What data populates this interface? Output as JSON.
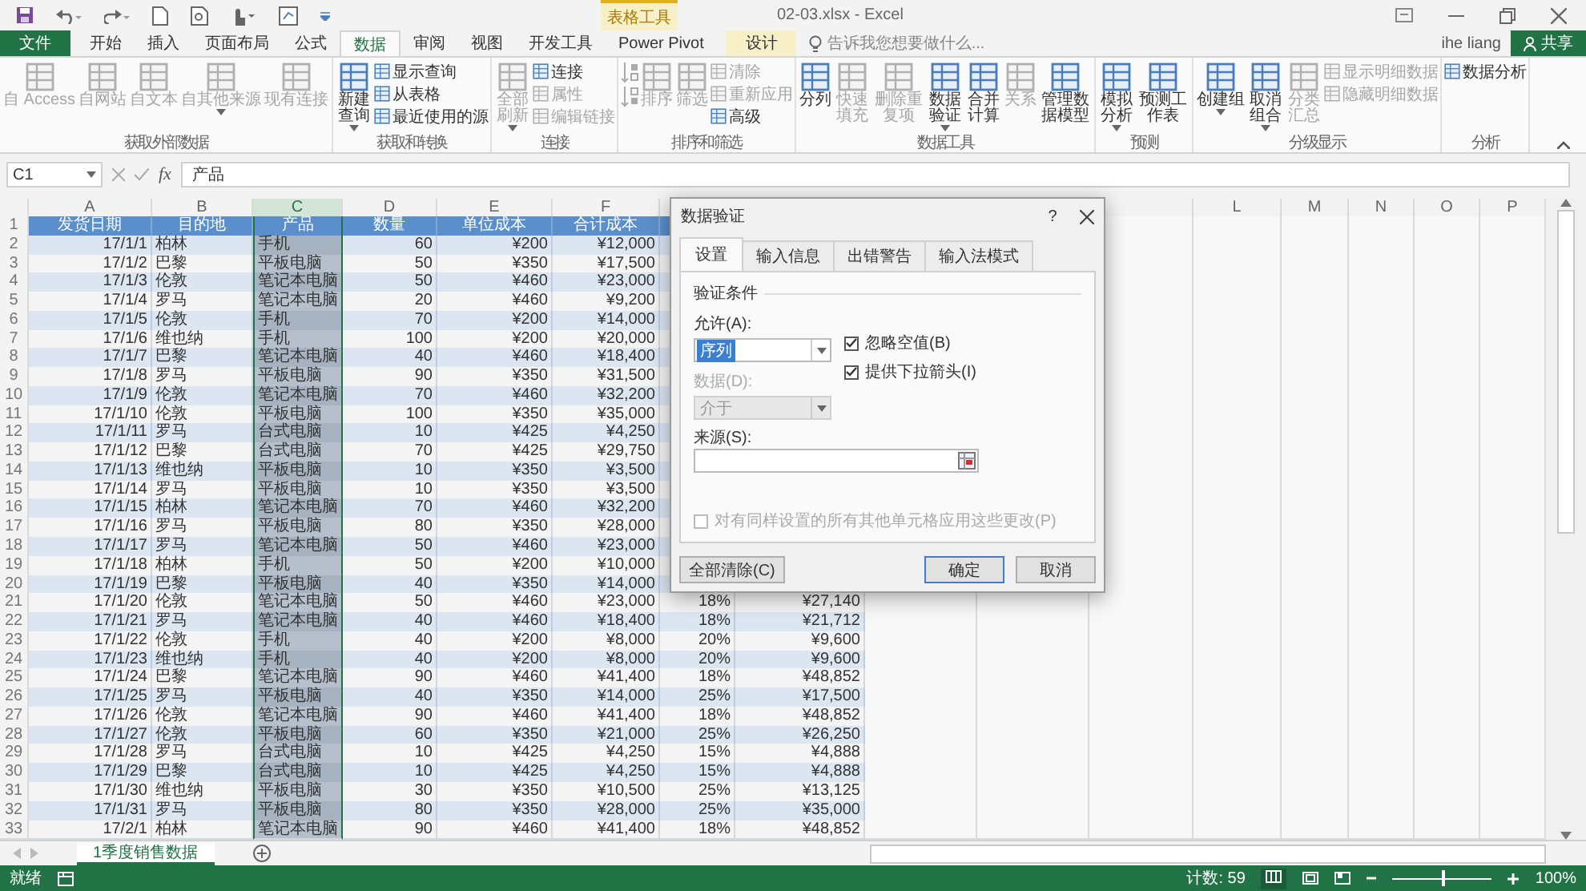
{
  "title_bar": {
    "context_label": "表格工具",
    "title": "02-03.xlsx - Excel"
  },
  "tabs": [
    {
      "label": "文件",
      "kind": "file",
      "selected": false
    },
    {
      "label": "开始",
      "kind": "tab",
      "selected": false
    },
    {
      "label": "插入",
      "kind": "tab",
      "selected": false
    },
    {
      "label": "页面布局",
      "kind": "tab",
      "selected": false
    },
    {
      "label": "公式",
      "kind": "tab",
      "selected": false
    },
    {
      "label": "数据",
      "kind": "tab",
      "selected": true
    },
    {
      "label": "审阅",
      "kind": "tab",
      "selected": false
    },
    {
      "label": "视图",
      "kind": "tab",
      "selected": false
    },
    {
      "label": "开发工具",
      "kind": "tab",
      "selected": false
    },
    {
      "label": "Power Pivot",
      "kind": "tab",
      "selected": false
    },
    {
      "label": "设计",
      "kind": "context",
      "selected": false
    }
  ],
  "search": {
    "placeholder": "告诉我您想要做什么..."
  },
  "user": {
    "name": "ihe liang",
    "share": "共享"
  },
  "ribbon": [
    {
      "label": "获取外部数据",
      "items": [
        {
          "kind": "large",
          "label": "自 Access",
          "disabled": true
        },
        {
          "kind": "large",
          "label": "自网站",
          "disabled": true
        },
        {
          "kind": "large",
          "label": "自文本",
          "disabled": true
        },
        {
          "kind": "large",
          "label": "自其他来源",
          "disabled": true,
          "dropdown": true
        },
        {
          "kind": "large",
          "label": "现有连接",
          "disabled": true
        }
      ]
    },
    {
      "label": "获取和转换",
      "items": [
        {
          "kind": "large",
          "label": "新建查询",
          "wrap": true,
          "disabled": false,
          "dropdown": true
        },
        {
          "kind": "stack",
          "items": [
            {
              "label": "显示查询",
              "disabled": false
            },
            {
              "label": "从表格",
              "disabled": false
            },
            {
              "label": "最近使用的源",
              "disabled": false
            }
          ]
        }
      ]
    },
    {
      "label": "连接",
      "items": [
        {
          "kind": "large",
          "label": "全部刷新",
          "disabled": true,
          "dropdown": true,
          "wrap": true
        },
        {
          "kind": "stack",
          "items": [
            {
              "label": "连接",
              "disabled": false
            },
            {
              "label": "属性",
              "disabled": true
            },
            {
              "label": "编辑链接",
              "disabled": true
            }
          ]
        }
      ]
    },
    {
      "label": "排序和筛选",
      "items": [
        {
          "kind": "sort_icons",
          "disabled": true
        },
        {
          "kind": "large",
          "label": "排序",
          "disabled": true
        },
        {
          "kind": "large",
          "label": "筛选",
          "disabled": true
        },
        {
          "kind": "stack",
          "items": [
            {
              "label": "清除",
              "disabled": true
            },
            {
              "label": "重新应用",
              "disabled": true
            },
            {
              "label": "高级",
              "disabled": false
            }
          ]
        }
      ]
    },
    {
      "label": "数据工具",
      "items": [
        {
          "kind": "large",
          "label": "分列",
          "disabled": false
        },
        {
          "kind": "large",
          "label": "快速填充",
          "disabled": true,
          "wrap": true
        },
        {
          "kind": "large",
          "label": "删除重复项",
          "wrap": true,
          "disabled": true
        },
        {
          "kind": "large",
          "label": "数据验证",
          "wrap": true,
          "disabled": false,
          "dropdown": true
        },
        {
          "kind": "large",
          "label": "合并计算",
          "disabled": false,
          "wrap": true
        },
        {
          "kind": "large",
          "label": "关系",
          "disabled": true
        },
        {
          "kind": "large",
          "label": "管理数据模型",
          "wrap": true,
          "disabled": false
        }
      ]
    },
    {
      "label": "预测",
      "items": [
        {
          "kind": "large",
          "label": "模拟分析",
          "disabled": false,
          "dropdown": true,
          "wrap": true
        },
        {
          "kind": "large",
          "label": "预测工作表",
          "wrap": true,
          "disabled": false
        }
      ]
    },
    {
      "label": "分级显示",
      "items": [
        {
          "kind": "large",
          "label": "创建组",
          "disabled": false,
          "dropdown": true
        },
        {
          "kind": "large",
          "label": "取消组合",
          "disabled": false,
          "dropdown": true,
          "wrap": true
        },
        {
          "kind": "large",
          "label": "分类汇总",
          "disabled": true,
          "wrap": true
        },
        {
          "kind": "stack",
          "items": [
            {
              "label": "显示明细数据",
              "disabled": true
            },
            {
              "label": "隐藏明细数据",
              "disabled": true
            }
          ]
        }
      ]
    },
    {
      "label": "分析",
      "items": [
        {
          "kind": "stack",
          "items": [
            {
              "label": "数据分析",
              "disabled": false
            }
          ]
        }
      ]
    }
  ],
  "formula_bar": {
    "name_box": "C1",
    "function_label": "fx",
    "value": "产品"
  },
  "sheet": {
    "column_headers_left": [
      {
        "letter": "A",
        "selected": false
      },
      {
        "letter": "B",
        "selected": false
      },
      {
        "letter": "C",
        "selected": true
      },
      {
        "letter": "D",
        "selected": false
      },
      {
        "letter": "E",
        "selected": false
      },
      {
        "letter": "F",
        "selected": false
      }
    ],
    "column_headers_right": [
      {
        "letter": "L",
        "selected": false
      },
      {
        "letter": "M",
        "selected": false
      },
      {
        "letter": "N",
        "selected": false
      },
      {
        "letter": "O",
        "selected": false
      },
      {
        "letter": "P",
        "selected": false
      }
    ],
    "rows": [
      {
        "number": "1",
        "kind": "header",
        "cells": [
          "发货日期",
          "目的地",
          "产品",
          "数量",
          "单位成本",
          "合计成本"
        ]
      },
      {
        "number": "2",
        "kind": "data",
        "cells": [
          "17/1/1",
          "柏林",
          "手机",
          "60",
          "¥200",
          "¥12,000"
        ]
      },
      {
        "number": "3",
        "kind": "data",
        "cells": [
          "17/1/2",
          "巴黎",
          "平板电脑",
          "50",
          "¥350",
          "¥17,500"
        ]
      },
      {
        "number": "4",
        "kind": "data",
        "cells": [
          "17/1/3",
          "伦敦",
          "笔记本电脑",
          "50",
          "¥460",
          "¥23,000"
        ]
      },
      {
        "number": "5",
        "kind": "data",
        "cells": [
          "17/1/4",
          "罗马",
          "笔记本电脑",
          "20",
          "¥460",
          "¥9,200"
        ]
      },
      {
        "number": "6",
        "kind": "data",
        "cells": [
          "17/1/5",
          "伦敦",
          "手机",
          "70",
          "¥200",
          "¥14,000"
        ]
      },
      {
        "number": "7",
        "kind": "data",
        "cells": [
          "17/1/6",
          "维也纳",
          "手机",
          "100",
          "¥200",
          "¥20,000"
        ]
      },
      {
        "number": "8",
        "kind": "data",
        "cells": [
          "17/1/7",
          "巴黎",
          "笔记本电脑",
          "40",
          "¥460",
          "¥18,400"
        ]
      },
      {
        "number": "9",
        "kind": "data",
        "cells": [
          "17/1/8",
          "罗马",
          "平板电脑",
          "90",
          "¥350",
          "¥31,500"
        ]
      },
      {
        "number": "10",
        "kind": "data",
        "cells": [
          "17/1/9",
          "伦敦",
          "笔记本电脑",
          "70",
          "¥460",
          "¥32,200"
        ]
      },
      {
        "number": "11",
        "kind": "data",
        "cells": [
          "17/1/10",
          "伦敦",
          "平板电脑",
          "100",
          "¥350",
          "¥35,000"
        ]
      },
      {
        "number": "12",
        "kind": "data",
        "cells": [
          "17/1/11",
          "罗马",
          "台式电脑",
          "10",
          "¥425",
          "¥4,250"
        ]
      },
      {
        "number": "13",
        "kind": "data",
        "cells": [
          "17/1/12",
          "巴黎",
          "台式电脑",
          "70",
          "¥425",
          "¥29,750"
        ]
      },
      {
        "number": "14",
        "kind": "data",
        "cells": [
          "17/1/13",
          "维也纳",
          "平板电脑",
          "10",
          "¥350",
          "¥3,500"
        ]
      },
      {
        "number": "15",
        "kind": "data",
        "cells": [
          "17/1/14",
          "罗马",
          "平板电脑",
          "10",
          "¥350",
          "¥3,500"
        ]
      },
      {
        "number": "16",
        "kind": "data",
        "cells": [
          "17/1/15",
          "柏林",
          "笔记本电脑",
          "70",
          "¥460",
          "¥32,200"
        ]
      },
      {
        "number": "17",
        "kind": "data",
        "cells": [
          "17/1/16",
          "罗马",
          "平板电脑",
          "80",
          "¥350",
          "¥28,000"
        ]
      },
      {
        "number": "18",
        "kind": "data",
        "cells": [
          "17/1/17",
          "罗马",
          "笔记本电脑",
          "50",
          "¥460",
          "¥23,000"
        ]
      },
      {
        "number": "19",
        "kind": "data",
        "cells": [
          "17/1/18",
          "柏林",
          "手机",
          "50",
          "¥200",
          "¥10,000"
        ]
      },
      {
        "number": "20",
        "kind": "data",
        "cells": [
          "17/1/19",
          "巴黎",
          "平板电脑",
          "40",
          "¥350",
          "¥14,000"
        ]
      },
      {
        "number": "21",
        "kind": "data",
        "cells": [
          "17/1/20",
          "伦敦",
          "笔记本电脑",
          "50",
          "¥460",
          "¥23,000",
          "18%",
          "¥27,140"
        ]
      },
      {
        "number": "22",
        "kind": "data",
        "cells": [
          "17/1/21",
          "罗马",
          "笔记本电脑",
          "40",
          "¥460",
          "¥18,400",
          "18%",
          "¥21,712"
        ]
      },
      {
        "number": "23",
        "kind": "data",
        "cells": [
          "17/1/22",
          "伦敦",
          "手机",
          "40",
          "¥200",
          "¥8,000",
          "20%",
          "¥9,600"
        ]
      },
      {
        "number": "24",
        "kind": "data",
        "cells": [
          "17/1/23",
          "维也纳",
          "手机",
          "40",
          "¥200",
          "¥8,000",
          "20%",
          "¥9,600"
        ]
      },
      {
        "number": "25",
        "kind": "data",
        "cells": [
          "17/1/24",
          "巴黎",
          "笔记本电脑",
          "90",
          "¥460",
          "¥41,400",
          "18%",
          "¥48,852"
        ]
      },
      {
        "number": "26",
        "kind": "data",
        "cells": [
          "17/1/25",
          "罗马",
          "平板电脑",
          "40",
          "¥350",
          "¥14,000",
          "25%",
          "¥17,500"
        ]
      },
      {
        "number": "27",
        "kind": "data",
        "cells": [
          "17/1/26",
          "伦敦",
          "笔记本电脑",
          "90",
          "¥460",
          "¥41,400",
          "18%",
          "¥48,852"
        ]
      },
      {
        "number": "28",
        "kind": "data",
        "cells": [
          "17/1/27",
          "伦敦",
          "平板电脑",
          "60",
          "¥350",
          "¥21,000",
          "25%",
          "¥26,250"
        ]
      },
      {
        "number": "29",
        "kind": "data",
        "cells": [
          "17/1/28",
          "罗马",
          "台式电脑",
          "10",
          "¥425",
          "¥4,250",
          "15%",
          "¥4,888"
        ]
      },
      {
        "number": "30",
        "kind": "data",
        "cells": [
          "17/1/29",
          "巴黎",
          "台式电脑",
          "10",
          "¥425",
          "¥4,250",
          "15%",
          "¥4,888"
        ]
      },
      {
        "number": "31",
        "kind": "data",
        "cells": [
          "17/1/30",
          "维也纳",
          "平板电脑",
          "30",
          "¥350",
          "¥10,500",
          "25%",
          "¥13,125"
        ]
      },
      {
        "number": "32",
        "kind": "data",
        "cells": [
          "17/1/31",
          "罗马",
          "平板电脑",
          "80",
          "¥350",
          "¥28,000",
          "25%",
          "¥35,000"
        ]
      },
      {
        "number": "33",
        "kind": "data",
        "cells": [
          "17/2/1",
          "柏林",
          "笔记本电脑",
          "90",
          "¥460",
          "¥41,400",
          "18%",
          "¥48,852"
        ]
      }
    ]
  },
  "dialog": {
    "title": "数据验证",
    "help": "?",
    "tabs": [
      {
        "label": "设置",
        "selected": true
      },
      {
        "label": "输入信息",
        "selected": false
      },
      {
        "label": "出错警告",
        "selected": false
      },
      {
        "label": "输入法模式",
        "selected": false
      }
    ],
    "section": "验证条件",
    "allow": {
      "label": "允许(A):",
      "value": "序列",
      "disabled": false
    },
    "options": [
      {
        "label": "忽略空值(B)",
        "checked": true
      },
      {
        "label": "提供下拉箭头(I)",
        "checked": true
      }
    ],
    "data": {
      "label": "数据(D):",
      "value": "介于",
      "disabled": true
    },
    "source": {
      "label": "来源(S):"
    },
    "apply_all": {
      "label": "对有同样设置的所有其他单元格应用这些更改(P)",
      "checked": false,
      "disabled": true
    },
    "buttons": [
      {
        "label": "全部清除(C)",
        "kind": "left"
      },
      {
        "label": "确定",
        "kind": "default"
      },
      {
        "label": "取消",
        "kind": "normal"
      }
    ]
  },
  "sheet_tabs": [
    {
      "label": "1季度销售数据",
      "selected": true
    }
  ],
  "status_bar": {
    "state": "就绪",
    "count": "计数: 59",
    "zoom": {
      "level": 0.5,
      "reading": "100%"
    }
  }
}
